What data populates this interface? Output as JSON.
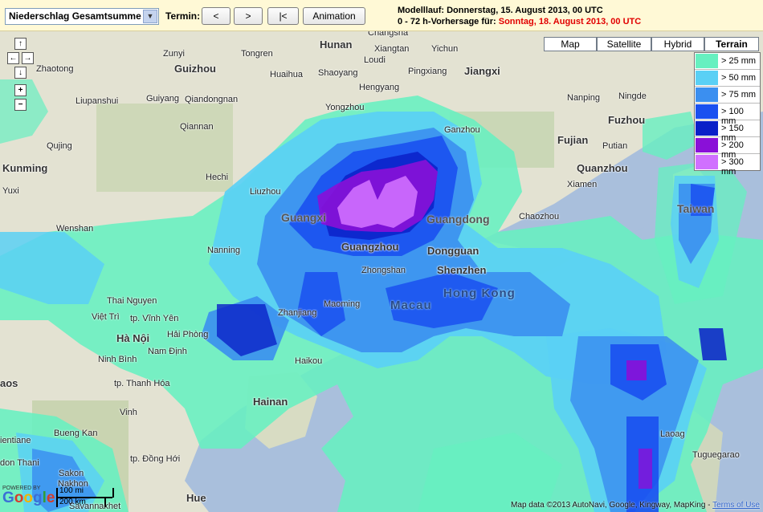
{
  "toolbar": {
    "product_select": "Niederschlag Gesamtsumme",
    "termin_label": "Termin:",
    "btn_prev": "<",
    "btn_next": ">",
    "btn_first": "|<",
    "btn_animation": "Animation"
  },
  "info": {
    "model_run": "Modelllauf: Donnerstag, 15. August 2013, 00 UTC",
    "forecast_prefix": "0 - 72 h-Vorhersage für:",
    "forecast_date": "Sonntag, 18. August 2013, 00 UTC"
  },
  "map_types": [
    "Map",
    "Satellite",
    "Hybrid",
    "Terrain"
  ],
  "active_map_type": "Terrain",
  "legend": [
    {
      "label": "> 25 mm",
      "color": "#66f0c0"
    },
    {
      "label": "> 50 mm",
      "color": "#5ad0f5"
    },
    {
      "label": "> 75 mm",
      "color": "#3b8ff0"
    },
    {
      "label": "> 100 mm",
      "color": "#1a50f0"
    },
    {
      "label": "> 150 mm",
      "color": "#0a20c8"
    },
    {
      "label": "> 200 mm",
      "color": "#8a10d8"
    },
    {
      "label": "> 300 mm",
      "color": "#d070ff"
    }
  ],
  "nav": {
    "up": "↑",
    "left": "←",
    "right": "→",
    "down": "↓",
    "zoom_in": "+",
    "zoom_out": "−"
  },
  "places": {
    "hunan": "Hunan",
    "changsha": "Changsha",
    "xiangtan": "Xiangtan",
    "yichun": "Yichun",
    "zunyi": "Zunyi",
    "tongren": "Tongren",
    "loudi": "Loudi",
    "zhaotong": "Zhaotong",
    "guizhou": "Guizhou",
    "huaihua": "Huaihua",
    "shaoyang": "Shaoyang",
    "pingxiang": "Pingxiang",
    "jiangxi": "Jiangxi",
    "guiyang": "Guiyang",
    "qiandongnan": "Qiandongnan",
    "liupanshui": "Liupanshui",
    "hengyang": "Hengyang",
    "yongzhou": "Yongzhou",
    "nanping": "Nanping",
    "ningde": "Ningde",
    "qiannan": "Qiannan",
    "ganzhou": "Ganzhou",
    "fuzhou": "Fuzhou",
    "qujing": "Qujing",
    "kunming": "Kunming",
    "yuxi": "Yuxi",
    "hechi": "Hechi",
    "fujian": "Fujian",
    "putian": "Putian",
    "quanzhou": "Quanzhou",
    "xiamen": "Xiamen",
    "liuzhou": "Liuzhou",
    "guangxi": "Guangxi",
    "guangdong": "Guangdong",
    "chaozhou": "Chaozhou",
    "taiwan": "Taiwan",
    "wenshan": "Wenshan",
    "nanning": "Nanning",
    "guangzhou": "Guangzhou",
    "dongguan": "Dongguan",
    "zhongshan": "Zhongshan",
    "shenzhen": "Shenzhen",
    "hongkong": "Hong Kong",
    "macau": "Macau",
    "maoming": "Maoming",
    "zhanjiang": "Zhanjiang",
    "thainguyen": "Thai Nguyen",
    "vinhyen": "tp. Vĩnh Yên",
    "vietri": "Việt Trì",
    "hanoi": "Hà Nội",
    "haiphong": "Hải Phòng",
    "namdinh": "Nam Định",
    "ninhbinh": "Ninh Bình",
    "thanhhoa": "tp. Thanh Hóa",
    "haikou": "Haikou",
    "hainan": "Hainan",
    "vinh": "Vinh",
    "laos": "aos",
    "buengkan": "Bueng Kan",
    "dongha": "tp. Đồng Hới",
    "vientiane": "ientiane",
    "udonthani": "don Thani",
    "sakon": "Sakon",
    "nakhon": "Nakhon",
    "savannakhet": "Savannakhet",
    "hue": "Hue",
    "laoag": "Laoag",
    "tuguegarao": "Tuguegarao",
    "hunan_top": "Changsha"
  },
  "scale": {
    "miles": "100 mi",
    "km": "200 km"
  },
  "powered_by": "POWERED BY",
  "google": "Google",
  "copyright": "Map data ©2013 AutoNavi, Google, Kingway, MapKing -",
  "terms": "Terms of Use"
}
